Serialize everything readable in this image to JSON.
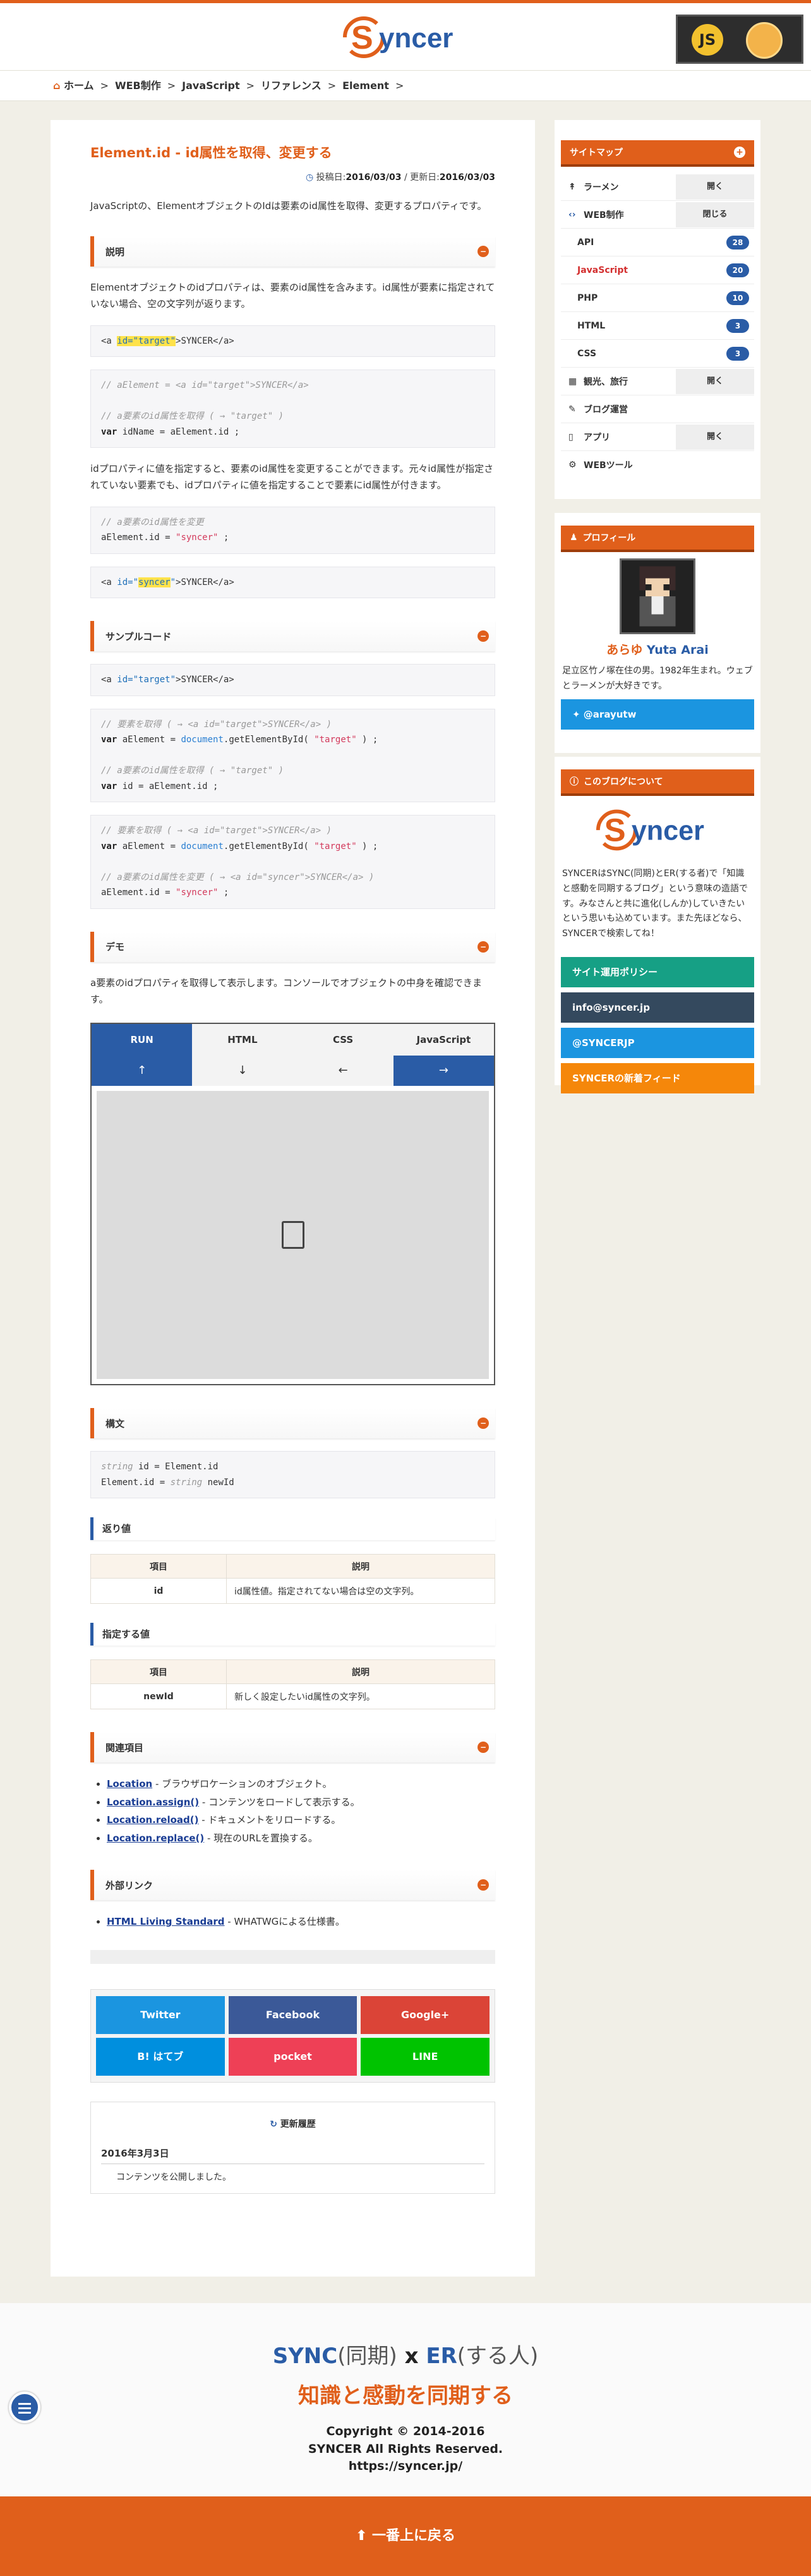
{
  "header": {
    "logo_text": "Syncer",
    "banner_js": "JS"
  },
  "breadcrumb": [
    "ホーム",
    "WEB制作",
    "JavaScript",
    "リファレンス",
    "Element"
  ],
  "article": {
    "title": "Element.id - id属性を取得、変更する",
    "posted_label": "投稿日:",
    "posted": "2016/03/03",
    "updated_label": " / 更新日:",
    "updated": "2016/03/03",
    "lead": "JavaScriptの、ElementオブジェクトのIdは要素のid属性を取得、変更するプロパティです。",
    "sections": {
      "explain": "説明",
      "sample": "サンプルコード",
      "demo": "デモ",
      "syntax": "構文",
      "related": "関連項目",
      "external": "外部リンク"
    },
    "explain_p1": "Elementオブジェクトのidプロパティは、要素のid属性を含みます。id属性が要素に指定されていない場合、空の文字列が返ります。",
    "explain_p2": "idプロパティに値を指定すると、要素のid属性を変更することができます。元々id属性が指定されていない要素でも、idプロパティに値を指定することで要素にid属性が付きます。",
    "demo_text": "a要素のidプロパティを取得して表示します。コンソールでオブジェクトの中身を確認できます。",
    "demo_tabs": [
      "RUN",
      "HTML",
      "CSS",
      "JavaScript"
    ],
    "demo_arrows": [
      "↑",
      "↓",
      "←",
      "→"
    ],
    "returns_title": "返り値",
    "params_title": "指定する値",
    "th_item": "項目",
    "th_desc": "説明",
    "returns_row": {
      "k": "id",
      "v": "id属性値。指定されてない場合は空の文字列。"
    },
    "params_row": {
      "k": "newId",
      "v": "新しく設定したいid属性の文字列。"
    },
    "related": [
      {
        "link": "Location",
        "desc": " - ブラウザロケーションのオブジェクト。"
      },
      {
        "link": "Location.assign()",
        "desc": " - コンテンツをロードして表示する。"
      },
      {
        "link": "Location.reload()",
        "desc": " - ドキュメントをリロードする。"
      },
      {
        "link": "Location.replace()",
        "desc": " - 現在のURLを置換する。"
      }
    ],
    "external": [
      {
        "link": "HTML Living Standard",
        "desc": " - WHATWGによる仕様書。"
      }
    ],
    "share": [
      {
        "label": "Twitter",
        "color": "#1b95e0"
      },
      {
        "label": "Facebook",
        "color": "#3b5998"
      },
      {
        "label": "Google+",
        "color": "#db4437"
      },
      {
        "label": "B! はてブ",
        "color": "#008fde"
      },
      {
        "label": "pocket",
        "color": "#ee4056"
      },
      {
        "label": "LINE",
        "color": "#00c300"
      }
    ],
    "history_title": "更新履歴",
    "history_date": "2016年3月3日",
    "history_item": "コンテンツを公開しました。"
  },
  "sidebar": {
    "sitemap_title": "サイトマップ",
    "open": "開く",
    "close": "閉じる",
    "items": [
      {
        "label": "ラーメン",
        "btn": "開く"
      },
      {
        "label": "WEB制作",
        "btn": "閉じる"
      }
    ],
    "sub": [
      {
        "label": "API",
        "count": "28"
      },
      {
        "label": "JavaScript",
        "count": "20"
      },
      {
        "label": "PHP",
        "count": "10"
      },
      {
        "label": "HTML",
        "count": "3"
      },
      {
        "label": "CSS",
        "count": "3"
      }
    ],
    "items2": [
      {
        "label": "観光、旅行",
        "btn": "開く"
      },
      {
        "label": "ブログ運営",
        "btn": ""
      },
      {
        "label": "アプリ",
        "btn": "開く"
      },
      {
        "label": "WEBツール",
        "btn": ""
      }
    ],
    "profile_title": "プロフィール",
    "profile_name": "あらゆ",
    "profile_name_en": "Yuta Arai",
    "profile_bio": "足立区竹ノ塚在住の男。1982年生まれ。ウェブとラーメンが大好きです。",
    "profile_twitter": "@arayutw",
    "about_title": "このブログについて",
    "about_logo": "Syncer",
    "about_text": "SYNCERはSYNC(同期)とER(する者)で「知識と感動を同期するブログ」という意味の造語です。みなさんと共に進化(しんか)していきたいという思いも込めています。また先ほどなら、SYNCERで検索してね！",
    "buttons": [
      {
        "label": "サイト運用ポリシー",
        "color": "#16a085"
      },
      {
        "label": "info@syncer.jp",
        "color": "#34495e"
      },
      {
        "label": "@SYNCERJP",
        "color": "#1b95e0"
      },
      {
        "label": "SYNCERの新着フィード",
        "color": "#f5870a"
      }
    ]
  },
  "footer": {
    "sync": "SYNC",
    "sync_jp": "(同期)",
    "x": " x ",
    "er": "ER",
    "er_jp": "(する人)",
    "tagline": "知識と感動を同期する",
    "copyright": "Copyright © 2014-2016",
    "rights": "SYNCER All Rights Reserved.",
    "url": "https://syncer.jp/",
    "totop": "一番上に戻る"
  },
  "colors": {
    "accent": "#e05f1b",
    "blue": "#2a5ca6"
  }
}
